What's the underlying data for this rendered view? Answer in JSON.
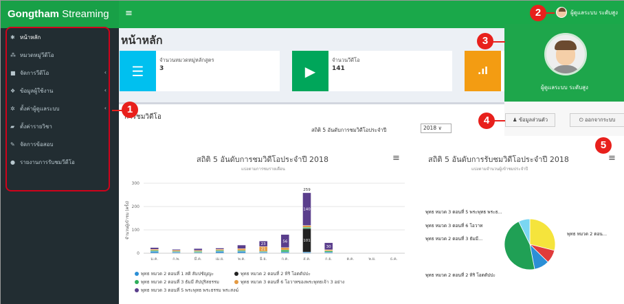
{
  "app": {
    "logo_bold": "Gongtham",
    "logo_rest": " Streaming",
    "menu_toggle": "≡",
    "user_label": "ผู้ดูแลระบบ ระดับสูง"
  },
  "sidebar": {
    "items": [
      {
        "icon": "home-icon",
        "glyph": "✱",
        "label": "หน้าหลัก",
        "caret": ""
      },
      {
        "icon": "sitemap-icon",
        "glyph": "⁂",
        "label": "หมวดหมู่วีดีโอ",
        "caret": ""
      },
      {
        "icon": "video-icon",
        "glyph": "■",
        "label": "จัดการวีดีโอ",
        "caret": "‹"
      },
      {
        "icon": "users-icon",
        "glyph": "❖",
        "label": "ข้อมูลผู้ใช้งาน",
        "caret": "‹"
      },
      {
        "icon": "settings-icon",
        "glyph": "✲",
        "label": "ตั้งค่าผู้ดูแลระบบ",
        "caret": "‹"
      },
      {
        "icon": "book-icon",
        "glyph": "▰",
        "label": "ตั้งค่ารายวิชา",
        "caret": ""
      },
      {
        "icon": "edit-icon",
        "glyph": "✎",
        "label": "จัดการข้อสอบ",
        "caret": ""
      },
      {
        "icon": "report-icon",
        "glyph": "●",
        "label": "รายงานการรับชมวีดีโอ",
        "caret": ""
      }
    ]
  },
  "main": {
    "page_title": "หน้าหลัก",
    "info_boxes": [
      {
        "icon": "list-icon",
        "glyph": "☰",
        "color": "#00c0ef",
        "label": "จำนวนหมวดหมู่หลักสูตร",
        "value": "3"
      },
      {
        "icon": "camera-icon",
        "glyph": "▶",
        "color": "#00a65a",
        "label": "จำนวนวีดีโอ",
        "value": "141"
      },
      {
        "icon": "bar-chart-icon",
        "glyph": ".ıl",
        "color": "#f39c12",
        "label": "",
        "value": ""
      }
    ],
    "panel_title": "การชมวิดีโอ",
    "filter_label": "สถิติ 5 อันดับการชมวิดีโอประจำปี",
    "year_value": "2018 ∨"
  },
  "user_dropdown": {
    "name": "ผู้ดูแลระบบ ระดับสูง",
    "profile_button": "♟ ข้อมูลส่วนตัว",
    "logout_button": "⏻ ออกจากระบบ"
  },
  "annotations": [
    "1",
    "2",
    "3",
    "4",
    "5"
  ],
  "colors": {
    "accent": "#1aa84a",
    "annotation": "#e8201c",
    "sidebar": "#222d32"
  },
  "chart_data": [
    {
      "type": "bar",
      "title": "สถิติ 5 อันดับการชมวิดีโอประจำปี 2018",
      "subtitle": "แบ่งตามการชมรายเดือน",
      "ylabel": "จำนวนผู้เข้าชม (ครั้ง)",
      "ylim": [
        0,
        300
      ],
      "yticks": [
        "0",
        "100",
        "200",
        "300"
      ],
      "categories": [
        "ม.ค.",
        "ก.พ.",
        "มี.ค.",
        "เม.ย.",
        "พ.ค.",
        "มิ.ย.",
        "ก.ค.",
        "ส.ค.",
        "ก.ย.",
        "ต.ค.",
        "พ.ย.",
        "ธ.ค."
      ],
      "totals": [
        "",
        "",
        "",
        "",
        "",
        "",
        "",
        "259",
        "",
        "",
        "",
        ""
      ],
      "series": [
        {
          "name": "พุทธ หมวด 2 ตอนที่ 1 สติ สัมปชัญญะ",
          "color": "#2b8fd6",
          "values": [
            8,
            5,
            4,
            8,
            8,
            5,
            6,
            5,
            5,
            0,
            0,
            0
          ]
        },
        {
          "name": "พุทธ หมวด 2 ตอนที่ 2 หิริ โอตตัปปะ",
          "color": "#222222",
          "values": [
            0,
            0,
            0,
            0,
            0,
            0,
            0,
            101,
            0,
            0,
            0,
            0
          ]
        },
        {
          "name": "พุทธ หมวด 2 ตอนที่ 3 ธัมมี สัปปุริสธรรม",
          "color": "#2dae5a",
          "values": [
            4,
            3,
            4,
            4,
            4,
            3,
            8,
            5,
            5,
            0,
            0,
            0
          ]
        },
        {
          "name": "พุทธ หมวด 3 ตอนที่ 6 โอวาทของพระพุทธเจ้า 3 อย่าง",
          "color": "#e39a43",
          "values": [
            5,
            5,
            4,
            5,
            8,
            21,
            10,
            8,
            5,
            0,
            0,
            0
          ]
        },
        {
          "name": "พุทธ หมวด 3 ตอนที่ 5 พระพุทธ พระธรรม พระสงฆ์",
          "color": "#5a3e8c",
          "values": [
            7,
            4,
            8,
            5,
            15,
            23,
            56,
            140,
            30,
            0,
            0,
            0
          ]
        }
      ],
      "legend": "bottom"
    },
    {
      "type": "pie",
      "title": "สถิติ 5 อันดับการรับชมวิดีโอประจำปี 2018",
      "subtitle": "แบ่งตามจำนวนผู้เข้าชมประจำปี",
      "labels": [
        "พุทธ หมวด 3 ตอนที่ 5 พระพุทธ พระธ...",
        "พุทธ หมวด 3 ตอนที่ 6 โอวาท",
        "พุทธ หมวด 2 ตอนที่ 3 ธัมมี...",
        "พุทธ หมวด 2 ตอนที่ 2 หิริ โอตตัปปะ",
        "พุทธ หมวด 2 ตอน..."
      ],
      "values": [
        24,
        7,
        8,
        38,
        6
      ],
      "colors": [
        "#f5e43c",
        "#e03b3b",
        "#2b8fd6",
        "#20a055",
        "#7ad6f2"
      ]
    }
  ]
}
